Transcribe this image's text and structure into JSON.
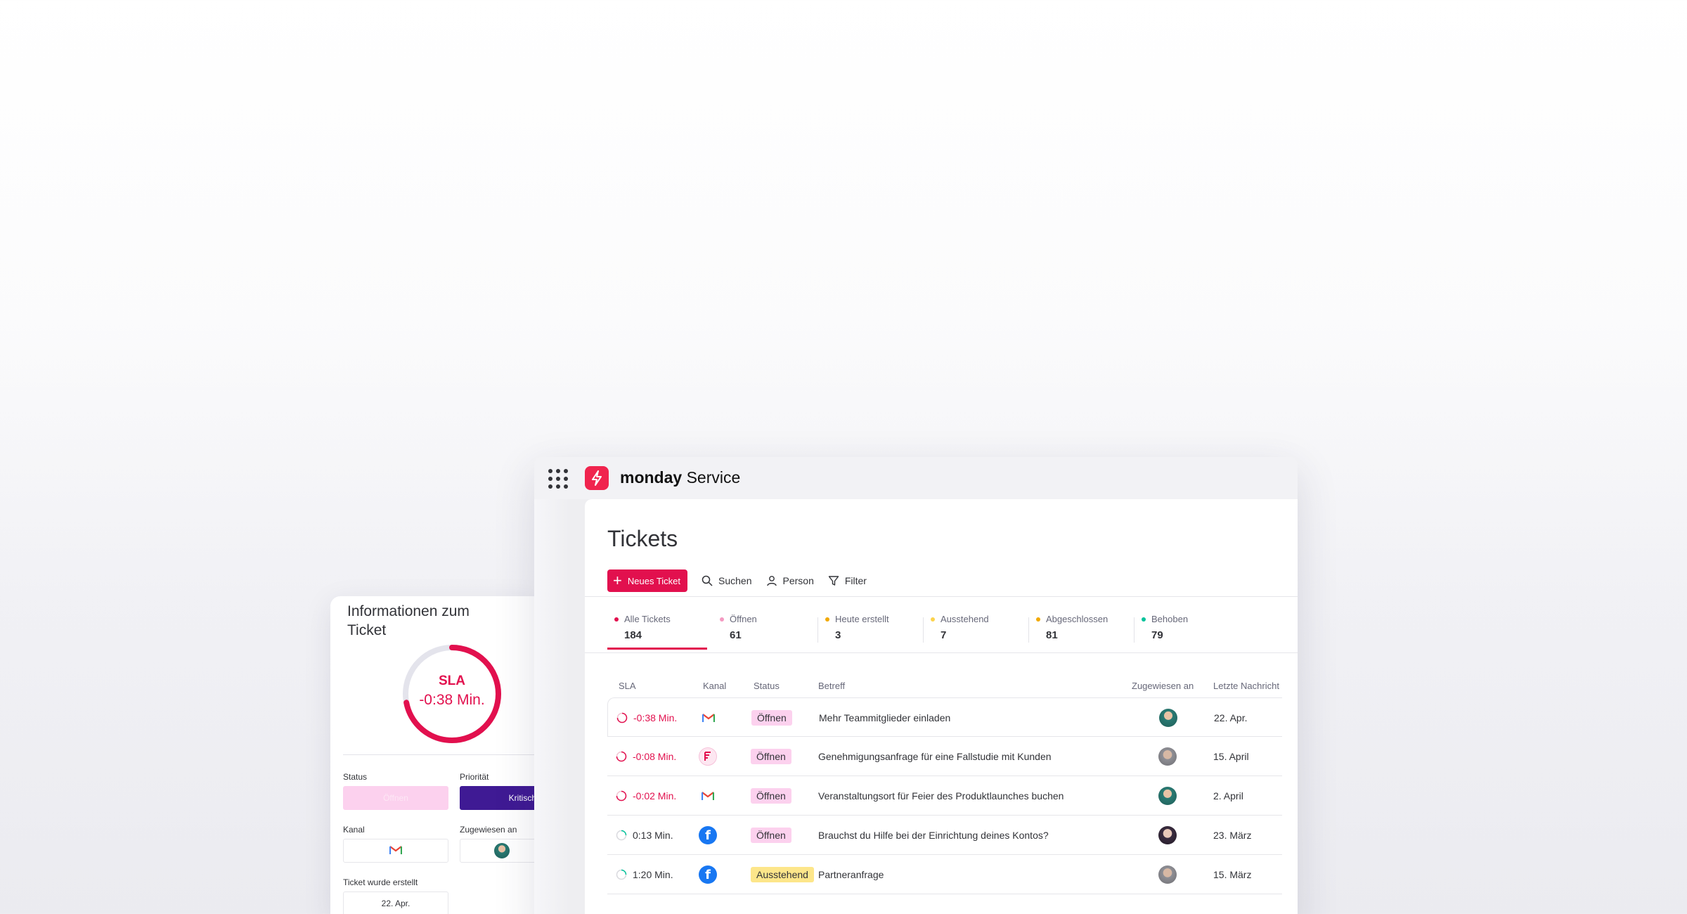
{
  "info_panel": {
    "title": "Informationen zum Ticket",
    "sla_label": "SLA",
    "sla_value": "-0:38 Min.",
    "sla_progress": 0.72,
    "status_label": "Status",
    "status_value": "Öffnen",
    "priority_label": "Priorität",
    "priority_value": "Kritisch",
    "channel_label": "Kanal",
    "channel_icon": "gmail-icon",
    "assigned_label": "Zugewiesen an",
    "created_label": "Ticket wurde erstellt",
    "created_value": "22. Apr."
  },
  "app": {
    "brand_bold": "monday",
    "brand_light": "Service",
    "page_title": "Tickets",
    "toolbar": {
      "new_ticket": "Neues Ticket",
      "search": "Suchen",
      "person": "Person",
      "filter": "Filter"
    },
    "tabs": [
      {
        "label": "Alle Tickets",
        "count": "184",
        "color": "#e2104e"
      },
      {
        "label": "Öffnen",
        "count": "61",
        "color": "#f49ac1"
      },
      {
        "label": "Heute erstellt",
        "count": "3",
        "color": "#f2a900"
      },
      {
        "label": "Ausstehend",
        "count": "7",
        "color": "#fcd34d"
      },
      {
        "label": "Abgeschlossen",
        "count": "81",
        "color": "#f2a900"
      },
      {
        "label": "Behoben",
        "count": "79",
        "color": "#00c29a"
      }
    ],
    "columns": {
      "sla": "SLA",
      "channel": "Kanal",
      "status": "Status",
      "subject": "Betreff",
      "assigned": "Zugewiesen an",
      "last_message": "Letzte Nachricht"
    },
    "rows": [
      {
        "sla": "-0:38 Min.",
        "overdue": true,
        "channel": "gmail-icon",
        "status": "Öffnen",
        "subject": "Mehr Teammitglieder einladen",
        "last": "22. Apr."
      },
      {
        "sla": "-0:08 Min.",
        "overdue": true,
        "channel": "form-icon",
        "status": "Öffnen",
        "subject": "Genehmigungsanfrage für eine Fallstudie mit Kunden",
        "last": "15. April"
      },
      {
        "sla": "-0:02 Min.",
        "overdue": true,
        "channel": "gmail-icon",
        "status": "Öffnen",
        "subject": "Veranstaltungsort für Feier des Produktlaunches buchen",
        "last": "2. April"
      },
      {
        "sla": "0:13 Min.",
        "overdue": false,
        "channel": "facebook-icon",
        "status": "Öffnen",
        "subject": "Brauchst du Hilfe bei der Einrichtung deines Kontos?",
        "last": "23. März"
      },
      {
        "sla": "1:20 Min.",
        "overdue": false,
        "channel": "facebook-icon",
        "status": "Ausstehend",
        "subject": "Partneranfrage",
        "last": "15. März"
      }
    ]
  }
}
